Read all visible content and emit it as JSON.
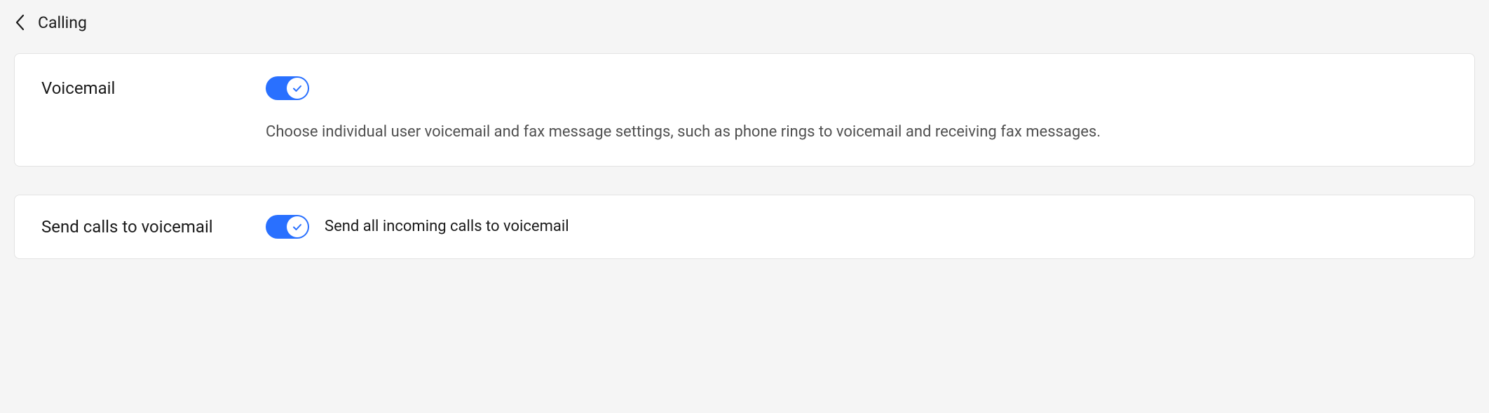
{
  "header": {
    "title": "Calling"
  },
  "settings": {
    "voicemail": {
      "label": "Voicemail",
      "toggle_on": true,
      "description": "Choose individual user voicemail and fax message settings, such as phone rings to voicemail and receiving fax messages."
    },
    "send_calls": {
      "label": "Send calls to voicemail",
      "toggle_on": true,
      "toggle_text": "Send all incoming calls to voicemail"
    }
  }
}
